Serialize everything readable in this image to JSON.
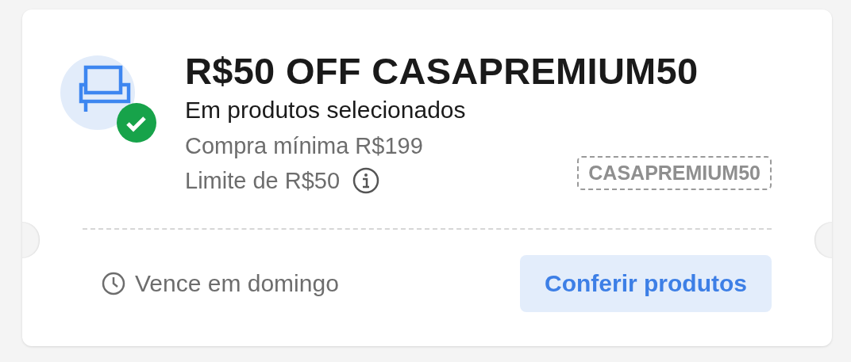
{
  "coupon": {
    "title": "R$50 OFF CASAPREMIUM50",
    "subtitle": "Em produtos selecionados",
    "min_purchase": "Compra mínima R$199",
    "limit": "Limite de R$50",
    "applied": true,
    "code": "CASAPREMIUM50",
    "expiry": "Vence em domingo",
    "button": "Conferir produtos"
  }
}
